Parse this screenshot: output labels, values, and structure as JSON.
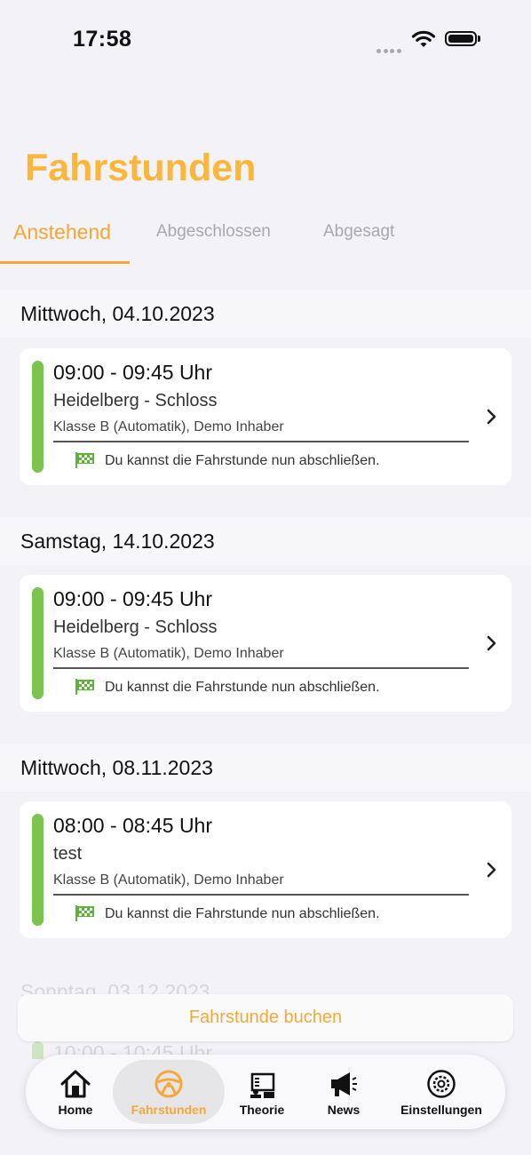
{
  "status": {
    "time": "17:58"
  },
  "page": {
    "title": "Fahrstunden"
  },
  "tabs": [
    {
      "label": "Anstehend",
      "active": true
    },
    {
      "label": "Abgeschlossen",
      "active": false
    },
    {
      "label": "Abgesagt",
      "active": false
    }
  ],
  "sections": [
    {
      "date": "Mittwoch, 04.10.2023",
      "lesson": {
        "time": "09:00 - 09:45 Uhr",
        "location": "Heidelberg - Schloss",
        "details": "Klasse B (Automatik), Demo Inhaber",
        "note": "Du kannst die Fahrstunde nun abschließen."
      }
    },
    {
      "date": "Samstag, 14.10.2023",
      "lesson": {
        "time": "09:00 - 09:45 Uhr",
        "location": "Heidelberg - Schloss",
        "details": "Klasse B (Automatik), Demo Inhaber",
        "note": "Du kannst die Fahrstunde nun abschließen."
      }
    },
    {
      "date": "Mittwoch, 08.11.2023",
      "lesson": {
        "time": "08:00 - 08:45 Uhr",
        "location": "test",
        "details": "Klasse B (Automatik), Demo Inhaber",
        "note": "Du kannst die Fahrstunde nun abschließen."
      }
    },
    {
      "date": "Sonntag, 03.12.2023",
      "lesson": {
        "time": "10:00 - 10:45 Uhr"
      }
    }
  ],
  "actions": {
    "book_label": "Fahrstunde buchen"
  },
  "tabbar": [
    {
      "label": "Home",
      "icon": "home-icon"
    },
    {
      "label": "Fahrstunden",
      "icon": "steering-wheel-icon",
      "active": true
    },
    {
      "label": "Theorie",
      "icon": "theory-board-icon"
    },
    {
      "label": "News",
      "icon": "megaphone-icon"
    },
    {
      "label": "Einstellungen",
      "icon": "settings-gear-icon"
    }
  ],
  "colors": {
    "accent": "#f7a534",
    "title": "#fbb63b",
    "status_bar_green": "#7cc34f",
    "flag_green": "#5cb33a",
    "background": "#f2f2f7"
  }
}
